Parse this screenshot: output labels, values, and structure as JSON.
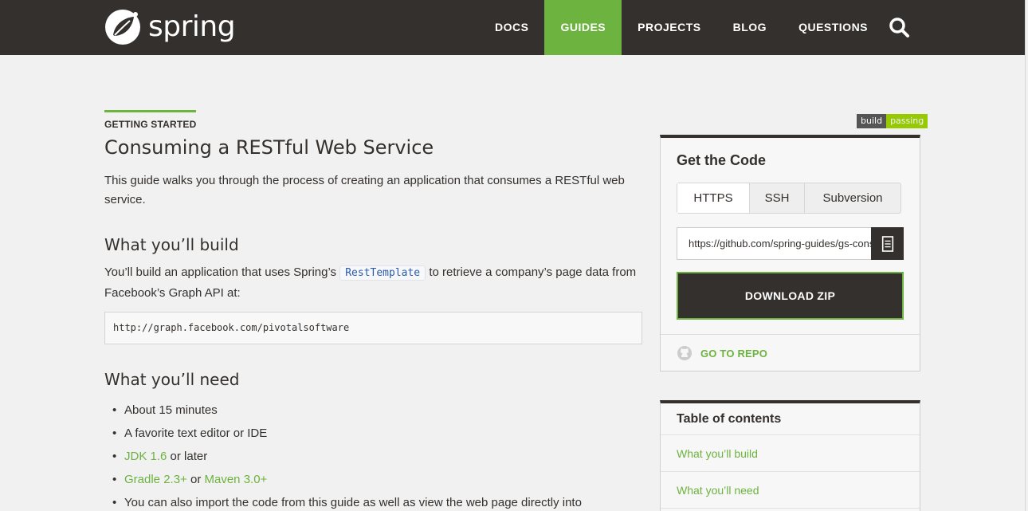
{
  "header": {
    "logo_text": "spring",
    "nav": [
      {
        "label": "DOCS",
        "active": false
      },
      {
        "label": "GUIDES",
        "active": true
      },
      {
        "label": "PROJECTS",
        "active": false
      },
      {
        "label": "BLOG",
        "active": false
      },
      {
        "label": "QUESTIONS",
        "active": false
      }
    ],
    "search_icon": "search-icon"
  },
  "main": {
    "eyebrow": "GETTING STARTED",
    "title": "Consuming a RESTful Web Service",
    "intro": "This guide walks you through the process of creating an application that consumes a RESTful web service.",
    "build_heading": "What you’ll build",
    "build_text_before": "You’ll build an application that uses Spring’s",
    "build_code": "RestTemplate",
    "build_text_after": "to retrieve a company’s page data from Facebook’s Graph API at:",
    "code_block": "http://graph.facebook.com/pivotalsoftware",
    "need_heading": "What you’ll need",
    "needs": {
      "item1": "About 15 minutes",
      "item2": "A favorite text editor or IDE",
      "jdk_link": "JDK 1.6",
      "jdk_suffix": " or later",
      "gradle_link": "Gradle 2.3+",
      "or": " or ",
      "maven_link": "Maven 3.0+",
      "item5": "You can also import the code from this guide as well as view the web page directly into"
    }
  },
  "sidebar": {
    "badge_left": "build",
    "badge_right": "passing",
    "get_code_title": "Get the Code",
    "protocols": [
      "HTTPS",
      "SSH",
      "Subversion"
    ],
    "selected_protocol": "HTTPS",
    "repo_url": "https://github.com/spring-guides/gs-consuming-rest.git",
    "download_label": "DOWNLOAD ZIP",
    "go_to_repo": "GO TO REPO",
    "toc_title": "Table of contents",
    "toc_items": [
      "What you’ll build",
      "What you’ll need"
    ]
  },
  "colors": {
    "brand_green": "#6db33f",
    "header_dark": "#34302d",
    "background": "#f1f1f1"
  }
}
